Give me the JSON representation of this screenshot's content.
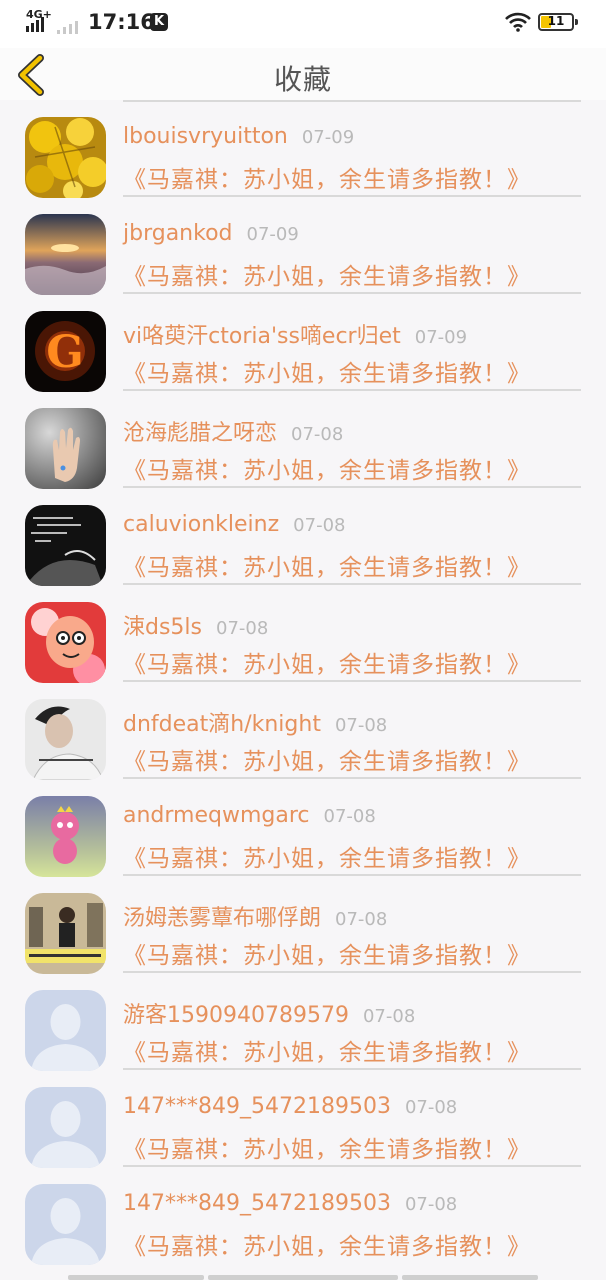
{
  "status_bar": {
    "network": "4G+",
    "time": "17:16",
    "app_badge": "K",
    "battery_level": "11"
  },
  "header": {
    "title": "收藏",
    "back_icon": "chevron-left-icon"
  },
  "colors": {
    "accent": "#e6915c",
    "back_icon": "#f2c200",
    "date": "#b9b9b9"
  },
  "favorites": [
    {
      "username": "lbouisvryuitton",
      "date": "07-09",
      "title": "《马嘉祺：苏小姐，余生请多指教！》",
      "avatar": "yellow-flowers-avatar"
    },
    {
      "username": "jbrgankod",
      "date": "07-09",
      "title": "《马嘉祺：苏小姐，余生请多指教！》",
      "avatar": "sunset-beach-avatar"
    },
    {
      "username": "vi咯萸汗ctoria'ss嘀ecr归et",
      "date": "07-09",
      "title": "《马嘉祺：苏小姐，余生请多指教！》",
      "avatar": "fire-letter-g-avatar"
    },
    {
      "username": "沧海彪腊之呀恋",
      "date": "07-08",
      "title": "《马嘉祺：苏小姐，余生请多指教！》",
      "avatar": "hand-avatar"
    },
    {
      "username": "caluvionkleinz",
      "date": "07-08",
      "title": "《马嘉祺：苏小姐，余生请多指教！》",
      "avatar": "dark-text-avatar"
    },
    {
      "username": "涑ds5ls",
      "date": "07-08",
      "title": "《马嘉祺：苏小姐，余生请多指教！》",
      "avatar": "cartoon-avatar"
    },
    {
      "username": "dnfdeat滴h/knight",
      "date": "07-08",
      "title": "《马嘉祺：苏小姐，余生请多指教！》",
      "avatar": "boy-photo-avatar"
    },
    {
      "username": "andrmeqwmgarc",
      "date": "07-08",
      "title": "《马嘉祺：苏小姐，余生请多指教！》",
      "avatar": "pink-doll-avatar"
    },
    {
      "username": "汤姆恙雾蕈布哪俘朗",
      "date": "07-08",
      "title": "《马嘉祺：苏小姐，余生请多指教！》",
      "avatar": "street-photo-avatar"
    },
    {
      "username": "游客1590940789579",
      "date": "07-08",
      "title": "《马嘉祺：苏小姐，余生请多指教！》",
      "avatar": "default-user-avatar"
    },
    {
      "username": "147***849_5472189503",
      "date": "07-08",
      "title": "《马嘉祺：苏小姐，余生请多指教！》",
      "avatar": "default-user-avatar"
    },
    {
      "username": "147***849_5472189503",
      "date": "07-08",
      "title": "《马嘉祺：苏小姐，余生请多指教！》",
      "avatar": "default-user-avatar"
    }
  ]
}
